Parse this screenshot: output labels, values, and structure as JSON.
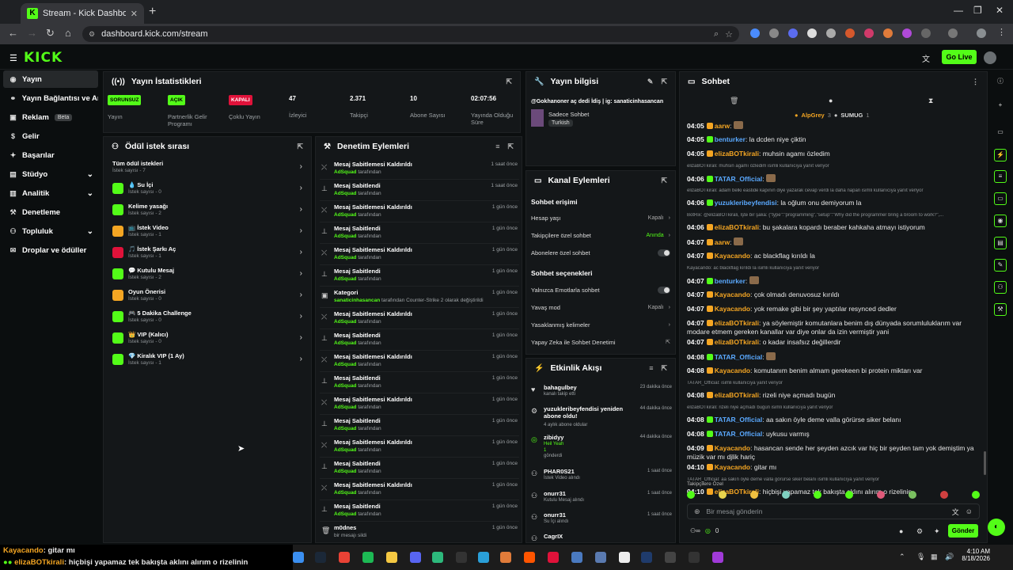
{
  "browser": {
    "tab_title": "Stream - Kick Dashboard",
    "url": "dashboard.kick.com/stream"
  },
  "header": {
    "logo": "KICK",
    "go_live": "Go Live"
  },
  "sidebar": {
    "items": [
      {
        "label": "Yayın"
      },
      {
        "label": "Yayın Bağlantısı ve Anahtarı"
      },
      {
        "label": "Reklam",
        "badge": "Beta"
      },
      {
        "label": "Gelir"
      },
      {
        "label": "Başarılar"
      },
      {
        "label": "Stüdyo"
      },
      {
        "label": "Analitik"
      },
      {
        "label": "Denetleme"
      },
      {
        "label": "Topluluk"
      },
      {
        "label": "Droplar ve ödüller"
      }
    ]
  },
  "stats": {
    "title": "Yayın İstatistikleri",
    "items": [
      {
        "value": "SORUNSUZ",
        "label": "Yayın"
      },
      {
        "value": "AÇIK",
        "label": "Partnerlik Gelir Programı"
      },
      {
        "value": "KAPALI",
        "label": "Çoklu Yayın"
      },
      {
        "value": "47",
        "label": "İzleyici"
      },
      {
        "value": "2.371",
        "label": "Takipçi"
      },
      {
        "value": "10",
        "label": "Abone Sayısı"
      },
      {
        "value": "02:07:56",
        "label": "Yayında Olduğu Süre"
      }
    ]
  },
  "stream_info": {
    "title": "Yayın bilgisi",
    "stream_title": "@Gokhanoner aç dedi İdiş | ig: sanaticinhasancan",
    "category": "Sadece Sohbet",
    "tag": "Turkish"
  },
  "rewards": {
    "title": "Ödül istek sırası",
    "all_label": "Tüm ödül istekleri",
    "all_count": "İstek sayısı - 7",
    "items": [
      {
        "name": "💧 Su İçi",
        "count": "İstek sayısı - 0"
      },
      {
        "name": "Kelime yasağı",
        "count": "İstek sayısı - 2"
      },
      {
        "name": "📺 İstek Video",
        "count": "İstek sayısı - 1"
      },
      {
        "name": "🎵 İstek Şarkı Aç",
        "count": "İstek sayısı - 1"
      },
      {
        "name": "💬 Kutulu Mesaj",
        "count": "İstek sayısı - 2"
      },
      {
        "name": "Oyun Önerisi",
        "count": "İstek sayısı - 0"
      },
      {
        "name": "🎮 5 Dakika Challenge",
        "count": "İstek sayısı - 0"
      },
      {
        "name": "👑 VIP (Kalıcı)",
        "count": "İstek sayısı - 0"
      },
      {
        "name": "💎 Kiralık VIP (1 Ay)",
        "count": "İstek sayısı - 1"
      }
    ]
  },
  "moderation": {
    "title": "Denetim Eylemleri",
    "items": [
      {
        "action": "Mesaj Sabitlemesi Kaldırıldı",
        "by": "AdSquad",
        "suffix": "tarafından",
        "time": "1 saat önce"
      },
      {
        "action": "Mesaj Sabitlendi",
        "by": "AdSquad",
        "suffix": "tarafından",
        "time": "1 saat önce"
      },
      {
        "action": "Mesaj Sabitlemesi Kaldırıldı",
        "by": "AdSquad",
        "suffix": "tarafından",
        "time": "1 gün önce"
      },
      {
        "action": "Mesaj Sabitlendi",
        "by": "AdSquad",
        "suffix": "tarafından",
        "time": "1 gün önce"
      },
      {
        "action": "Mesaj Sabitlemesi Kaldırıldı",
        "by": "AdSquad",
        "suffix": "tarafından",
        "time": "1 gün önce"
      },
      {
        "action": "Mesaj Sabitlendi",
        "by": "AdSquad",
        "suffix": "tarafından",
        "time": "1 gün önce"
      },
      {
        "action": "Kategori",
        "by": "sanaticinhasancan",
        "suffix": "tarafından Counter-Strike 2 olarak değiştirildi",
        "time": "1 gün önce"
      },
      {
        "action": "Mesaj Sabitlemesi Kaldırıldı",
        "by": "AdSquad",
        "suffix": "tarafından",
        "time": "1 gün önce"
      },
      {
        "action": "Mesaj Sabitlendi",
        "by": "AdSquad",
        "suffix": "tarafından",
        "time": "1 gün önce"
      },
      {
        "action": "Mesaj Sabitlemesi Kaldırıldı",
        "by": "AdSquad",
        "suffix": "tarafından",
        "time": "1 gün önce"
      },
      {
        "action": "Mesaj Sabitlendi",
        "by": "AdSquad",
        "suffix": "tarafından",
        "time": "1 gün önce"
      },
      {
        "action": "Mesaj Sabitlemesi Kaldırıldı",
        "by": "AdSquad",
        "suffix": "tarafından",
        "time": "1 gün önce"
      },
      {
        "action": "Mesaj Sabitlendi",
        "by": "AdSquad",
        "suffix": "tarafından",
        "time": "1 gün önce"
      },
      {
        "action": "Mesaj Sabitlemesi Kaldırıldı",
        "by": "AdSquad",
        "suffix": "tarafından",
        "time": "1 gün önce"
      },
      {
        "action": "Mesaj Sabitlendi",
        "by": "AdSquad",
        "suffix": "tarafından",
        "time": "1 gün önce"
      },
      {
        "action": "Mesaj Sabitlemesi Kaldırıldı",
        "by": "AdSquad",
        "suffix": "tarafından",
        "time": "1 gün önce"
      },
      {
        "action": "Mesaj Sabitlendi",
        "by": "AdSquad",
        "suffix": "tarafından",
        "time": "1 gün önce"
      },
      {
        "action": "m0dnes",
        "by": "",
        "suffix": "bir mesajı sildi",
        "time": "1 gün önce"
      }
    ]
  },
  "channel_actions": {
    "title": "Kanal Eylemleri",
    "section1": "Sohbet erişimi",
    "section2": "Sohbet seçenekleri",
    "rows": [
      {
        "label": "Hesap yaşı",
        "value": "Kapalı"
      },
      {
        "label": "Takipçilere özel sohbet",
        "value": "Anında"
      },
      {
        "label": "Abonelere özel sohbet",
        "value": ""
      },
      {
        "label": "Yalnızca Emotlarla sohbet",
        "value": ""
      },
      {
        "label": "Yavaş mod",
        "value": "Kapalı"
      },
      {
        "label": "Yasaklanmış kelimeler",
        "value": ""
      },
      {
        "label": "Yapay Zeka ile Sohbet Denetimi",
        "value": ""
      }
    ]
  },
  "activity": {
    "title": "Etkinlik Akışı",
    "items": [
      {
        "name": "bahagulbey",
        "detail": "kanalı takip etti",
        "time": "23 dakika önce"
      },
      {
        "name": "yuzukleribeyfendisi yeniden abone oldu!",
        "detail": "4 aylık abone oldular",
        "time": "44 dakika önce"
      },
      {
        "name": "zibidyy",
        "detail": "Heil Yeah",
        "detail2": "1",
        "detail3": "gönderdi",
        "time": "44 dakika önce"
      },
      {
        "name": "PHAR0S21",
        "detail": "İstek Video alındı",
        "time": "1 saat önce"
      },
      {
        "name": "onurr31",
        "detail": "Kutulu Mesaj alındı",
        "time": "1 saat önce"
      },
      {
        "name": "onurr31",
        "detail": "Su İçi alındı",
        "time": "1 saat önce"
      },
      {
        "name": "CagrIX",
        "detail": "",
        "time": ""
      }
    ]
  },
  "chat": {
    "title": "Sohbet",
    "pinned_users": [
      "AlpGrey",
      "3",
      "SUMUG",
      "1"
    ],
    "messages": [
      {
        "time": "04:05",
        "user": "aarw",
        "color": "#f5a623",
        "text": ""
      },
      {
        "time": "04:05",
        "user": "benturker",
        "color": "#5aa9ff",
        "text": "la dcden niye çiktin"
      },
      {
        "time": "04:05",
        "user": "elizaBOTkirali",
        "color": "#f5a623",
        "text": "muhsin agamı özledim"
      },
      {
        "reply": "elizaBOTkirali: muhsin agamı özledim isimli kullanıcıya yanıt veriyor"
      },
      {
        "time": "04:06",
        "user": "TATAR_Official",
        "color": "#5aa9ff",
        "text": ""
      },
      {
        "reply": "elizaBOTkirali: adam belki eastide kapının diye yazarak cevap verdi la daha napan isimli kullanıcıya yanıt veriyor"
      },
      {
        "time": "04:06",
        "user": "yuzukleribeyfendisi",
        "color": "#5aa9ff",
        "text": "la oğlum onu demiyorum la"
      },
      {
        "reply": "BotRix: @elizaBOTkirali, İşte bir şaka: {\"type\":\"programming\",\"setup\":\"Why did the programmer bring a broom to work?\",..."
      },
      {
        "time": "04:06",
        "user": "elizaBOTkirali",
        "color": "#f5a623",
        "text": "bu şakalara kopardı beraber kahkaha atmayı istiyorum"
      },
      {
        "time": "04:07",
        "user": "aarw",
        "color": "#f5a623",
        "text": ""
      },
      {
        "time": "04:07",
        "user": "Kayacando",
        "color": "#f5a623",
        "text": "ac blackflag kırıldı la"
      },
      {
        "reply": "Kayacando: ac blackflag kırıldı la isimli kullanıcıya yanıt veriyor"
      },
      {
        "time": "04:07",
        "user": "benturker",
        "color": "#5aa9ff",
        "text": ""
      },
      {
        "time": "04:07",
        "user": "Kayacando",
        "color": "#f5a623",
        "text": "çok olmadı denuvosuz kırıldı"
      },
      {
        "time": "04:07",
        "user": "Kayacando",
        "color": "#f5a623",
        "text": "yok remake gibi bir şey yaptılar resynced dedler"
      },
      {
        "time": "04:07",
        "user": "elizaBOTkirali",
        "color": "#f5a623",
        "text": "ya söylemiştir komutanlara benim dış dünyada sorumluluklarım var modare etmem gereken kanallar var diye onlar da izin vermiştir yani"
      },
      {
        "time": "04:07",
        "user": "elizaBOTkirali",
        "color": "#f5a623",
        "text": "o kadar insafsız değillerdir"
      },
      {
        "time": "04:08",
        "user": "TATAR_Official",
        "color": "#5aa9ff",
        "text": ""
      },
      {
        "time": "04:08",
        "user": "Kayacando",
        "color": "#f5a623",
        "text": "komutanım benim almam gerekeen bi protein miktarı var"
      },
      {
        "reply": "TATAR_Official: isimli kullanıcıya yanıt veriyor"
      },
      {
        "time": "04:08",
        "user": "elizaBOTkirali",
        "color": "#f5a623",
        "text": "rizeli niye açmadı bugün"
      },
      {
        "reply": "elizaBOTkirali: rizeli niye açmadı bugün isimli kullanıcıya yanıt veriyor"
      },
      {
        "time": "04:08",
        "user": "TATAR_Official",
        "color": "#5aa9ff",
        "text": "aa sakın öyle deme valla görürse siker belanı"
      },
      {
        "time": "04:08",
        "user": "TATAR_Official",
        "color": "#5aa9ff",
        "text": "uykusu varmış"
      },
      {
        "time": "04:09",
        "user": "Kayacando",
        "color": "#f5a623",
        "text": "hasancan sende her şeyden azcık var hiç bir şeyden tam yok demiştim ya müzik var mı djlik hariç"
      },
      {
        "time": "04:10",
        "user": "Kayacando",
        "color": "#f5a623",
        "text": "gitar mı"
      },
      {
        "reply": "TATAR_Official: aa sakın öyle deme valla görürse siker belanı isimli kullanıcıya yanıt veriyor"
      },
      {
        "time": "04:10",
        "user": "elizaBOTkirali",
        "color": "#f5a623",
        "text": "hiçbişi yapamaz tek bakışta aklını alırım o rizelinin"
      }
    ],
    "followers_only": "Takipçilere Özel",
    "input_placeholder": "Bir mesaj gönderin",
    "points": "0",
    "send": "Gönder"
  },
  "overlay": {
    "line1_user": "Kayacando",
    "line1_text": ": gitar mı",
    "line2_user": "elizaBOTkirali",
    "line2_text": ": hiçbişi yapamaz tek bakışta aklını alırım o rizelinin"
  },
  "taskbar": {
    "time": "4:10 AM",
    "date": "8/18/2026"
  },
  "colors": {
    "brand": "#53fc18",
    "user_orange": "#f5a623",
    "user_blue": "#5aa9ff"
  }
}
